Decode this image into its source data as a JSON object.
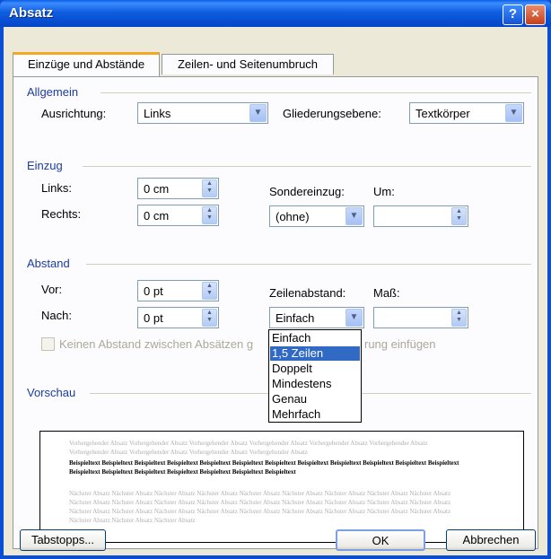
{
  "window": {
    "title": "Absatz",
    "help_icon": "?",
    "close_icon": "×"
  },
  "tabs": [
    {
      "label": "Einzüge und Abstände",
      "active": true
    },
    {
      "label": "Zeilen- und Seitenumbruch",
      "active": false
    }
  ],
  "allgemein": {
    "section": "Allgemein",
    "ausrichtung_label": "Ausrichtung:",
    "ausrichtung_value": "Links",
    "gliederung_label": "Gliederungsebene:",
    "gliederung_value": "Textkörper"
  },
  "einzug": {
    "section": "Einzug",
    "links_label": "Links:",
    "links_value": "0 cm",
    "rechts_label": "Rechts:",
    "rechts_value": "0 cm",
    "sondereinzug_label": "Sondereinzug:",
    "sondereinzug_value": "(ohne)",
    "um_label": "Um:",
    "um_value": ""
  },
  "abstand": {
    "section": "Abstand",
    "vor_label": "Vor:",
    "vor_value": "0 pt",
    "nach_label": "Nach:",
    "nach_value": "0 pt",
    "zeilenabstand_label": "Zeilenabstand:",
    "zeilenabstand_value": "Einfach",
    "mass_label": "Maß:",
    "mass_value": "",
    "checkbox_label_left": "Keinen Abstand zwischen Absätzen g",
    "checkbox_label_right": "rung einfügen"
  },
  "dropdown": {
    "options": [
      "Einfach",
      "1,5 Zeilen",
      "Doppelt",
      "Mindestens",
      "Genau",
      "Mehrfach"
    ],
    "highlighted": "1,5 Zeilen"
  },
  "vorschau": {
    "section": "Vorschau",
    "prev_text": "Vorhergehender Absatz Vorhergehender Absatz Vorhergehender Absatz Vorhergehender Absatz Vorhergehender Absatz Vorhergehender Absatz Vorhergehender Absatz Vorhergehender Absatz Vorhergehender Absatz Vorhergehender Absatz",
    "sample_text": "Beispieltext Beispieltext Beispieltext Beispieltext Beispieltext Beispieltext Beispieltext Beispieltext Beispieltext Beispieltext Beispieltext Beispieltext Beispieltext Beispieltext Beispieltext Beispieltext Beispieltext Beispieltext Beispieltext",
    "next_text": "Nächster Absatz Nächster Absatz Nächster Absatz Nächster Absatz Nächster Absatz Nächster Absatz Nächster Absatz Nächster Absatz Nächster Absatz Nächster Absatz Nächster Absatz Nächster Absatz Nächster Absatz Nächster Absatz Nächster Absatz Nächster Absatz Nächster Absatz Nächster Absatz Nächster Absatz Nächster Absatz Nächster Absatz Nächster Absatz Nächster Absatz Nächster Absatz Nächster Absatz Nächster Absatz Nächster Absatz Nächster Absatz Nächster Absatz Nächster Absatz"
  },
  "buttons": {
    "tabstopps": "Tabstopps...",
    "ok": "OK",
    "abbrechen": "Abbrechen"
  },
  "icons": {
    "combo_arrow": "▼",
    "spin_up": "▲",
    "spin_down": "▼"
  }
}
